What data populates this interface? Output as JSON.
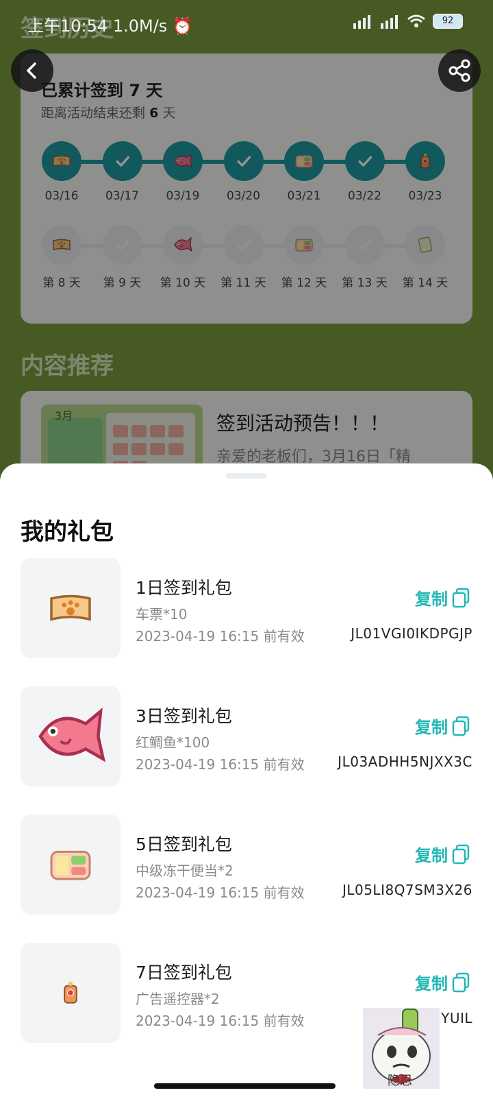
{
  "status_bar": {
    "time": "上午10:54",
    "speed": "1.0M/s",
    "battery": "92"
  },
  "background": {
    "history_heading": "签到历史",
    "cumulative_prefix": "已累计签到",
    "cumulative_days": "7",
    "cumulative_suffix": "天",
    "remaining_prefix": "距离活动结束还剩",
    "remaining_days": "6",
    "remaining_suffix": "天",
    "week1": [
      {
        "label": "03/16",
        "icon": "ticket-icon"
      },
      {
        "label": "03/17",
        "icon": "check-icon"
      },
      {
        "label": "03/19",
        "icon": "fish-icon"
      },
      {
        "label": "03/20",
        "icon": "check-icon"
      },
      {
        "label": "03/21",
        "icon": "bento-icon"
      },
      {
        "label": "03/22",
        "icon": "check-icon"
      },
      {
        "label": "03/23",
        "icon": "remote-icon"
      }
    ],
    "week2": [
      {
        "label": "第 8 天",
        "icon": "ticket-icon"
      },
      {
        "label": "第 9 天",
        "icon": "check-icon"
      },
      {
        "label": "第 10 天",
        "icon": "fish-icon"
      },
      {
        "label": "第 11 天",
        "icon": "check-icon"
      },
      {
        "label": "第 12 天",
        "icon": "bento-icon"
      },
      {
        "label": "第 13 天",
        "icon": "check-icon"
      },
      {
        "label": "第 14 天",
        "icon": "card-icon"
      }
    ],
    "recommend_heading": "内容推荐",
    "recommend_title": "签到活动预告！！！",
    "recommend_desc": "亲爱的老板们，3月16日「精"
  },
  "sheet": {
    "title": "我的礼包",
    "copy_label": "复制",
    "gifts": [
      {
        "name": "1日签到礼包",
        "item": "车票*10",
        "expire": "2023-04-19 16:15 前有效",
        "code": "JL01VGI0IKDPGJP",
        "icon": "ticket-icon"
      },
      {
        "name": "3日签到礼包",
        "item": "红鲷鱼*100",
        "expire": "2023-04-19 16:15 前有效",
        "code": "JL03ADHH5NJXX3C",
        "icon": "fish-icon"
      },
      {
        "name": "5日签到礼包",
        "item": "中级冻干便当*2",
        "expire": "2023-04-19 16:15 前有效",
        "code": "JL05LI8Q7SM3X26",
        "icon": "bento-icon"
      },
      {
        "name": "7日签到礼包",
        "item": "广告遥控器*2",
        "expire": "2023-04-19 16:15 前有效",
        "code": "JL07YUIL",
        "code_visible": "J…YUIL",
        "icon": "remote-icon"
      }
    ]
  },
  "overlay_sticker_text": "隐忍",
  "colors": {
    "accent": "#22b7b7",
    "track_active": "#1e9aa0",
    "background_green": "#7a9b3f"
  }
}
